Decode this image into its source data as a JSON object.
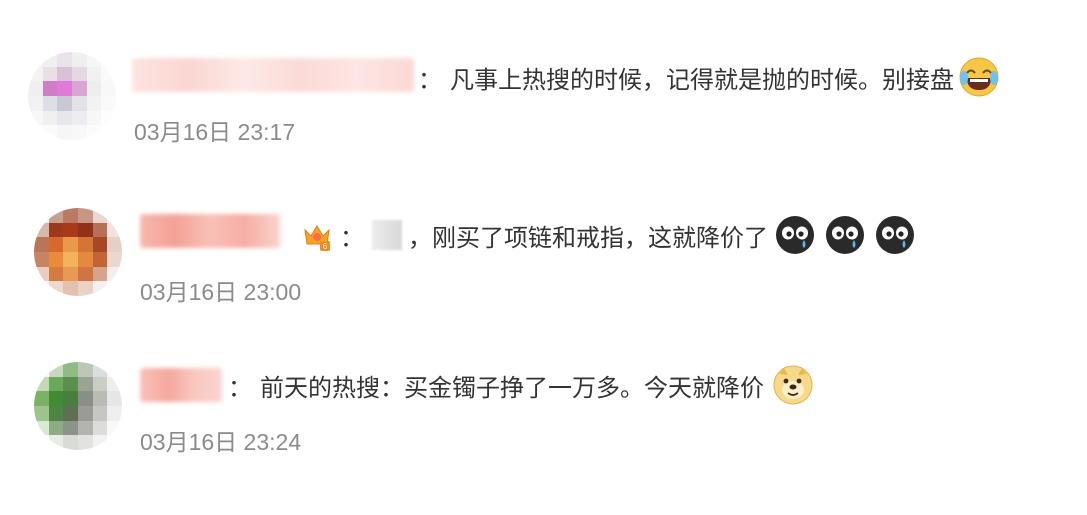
{
  "comments": [
    {
      "separator": "：",
      "text": "凡事上热搜的时候，记得就是抛的时候。别接盘",
      "emojis": [
        "laughing-tears-emoji"
      ],
      "time": "03月16日 23:17"
    },
    {
      "separator": "：",
      "prefix": "，",
      "text": "刚买了项链和戒指，这就降价了",
      "emojis": [
        "crying-face-emoji",
        "crying-face-emoji",
        "crying-face-emoji"
      ],
      "time": "03月16日 23:00"
    },
    {
      "separator": "：",
      "text": "前天的热搜：买金镯子挣了一万多。今天就降价",
      "emojis": [
        "doge-emoji"
      ],
      "time": "03月16日 23:24"
    }
  ],
  "colors": {
    "username_red": "#e8493a",
    "time_gray": "#8b8b8b",
    "text": "#333333"
  }
}
